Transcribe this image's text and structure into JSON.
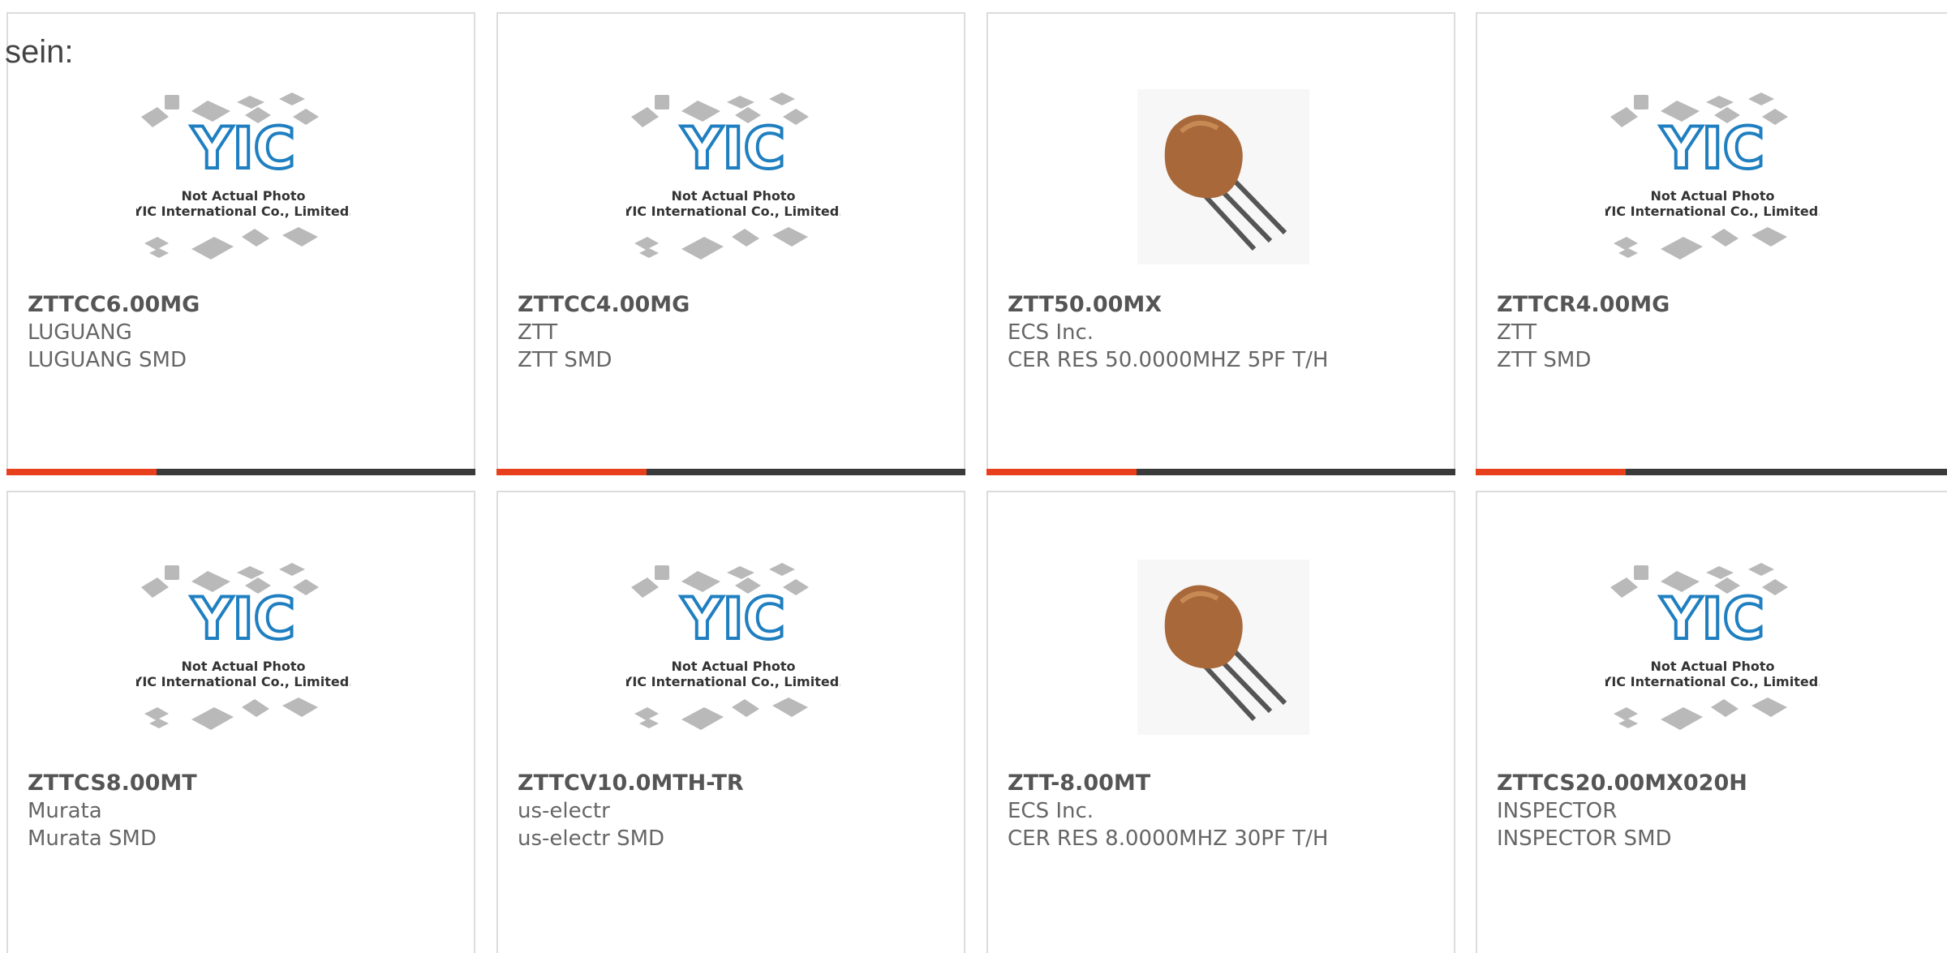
{
  "header_text": "sein:",
  "placeholder_caption_line1": "Not Actual Photo",
  "placeholder_caption_line2": "YIC International Co., Limited.",
  "placeholder_logo": "YIC",
  "accent_color": "#e8401c",
  "bar_color": "#3a3a3a",
  "products": [
    {
      "part": "ZTTCC6.00MG",
      "manufacturer": "LUGUANG",
      "description": "LUGUANG SMD",
      "image": "yic-placeholder"
    },
    {
      "part": "ZTTCC4.00MG",
      "manufacturer": "ZTT",
      "description": "ZTT SMD",
      "image": "yic-placeholder"
    },
    {
      "part": "ZTT50.00MX",
      "manufacturer": "ECS Inc.",
      "description": "CER RES 50.0000MHZ 5PF T/H",
      "image": "ceramic-resonator"
    },
    {
      "part": "ZTTCR4.00MG",
      "manufacturer": "ZTT",
      "description": "ZTT SMD",
      "image": "yic-placeholder"
    },
    {
      "part": "ZTTCS8.00MT",
      "manufacturer": "Murata",
      "description": "Murata SMD",
      "image": "yic-placeholder"
    },
    {
      "part": "ZTTCV10.0MTH-TR",
      "manufacturer": "us-electr",
      "description": "us-electr SMD",
      "image": "yic-placeholder"
    },
    {
      "part": "ZTT-8.00MT",
      "manufacturer": "ECS Inc.",
      "description": "CER RES 8.0000MHZ 30PF T/H",
      "image": "ceramic-resonator"
    },
    {
      "part": "ZTTCS20.00MX020H",
      "manufacturer": "INSPECTOR",
      "description": "INSPECTOR SMD",
      "image": "yic-placeholder"
    }
  ]
}
